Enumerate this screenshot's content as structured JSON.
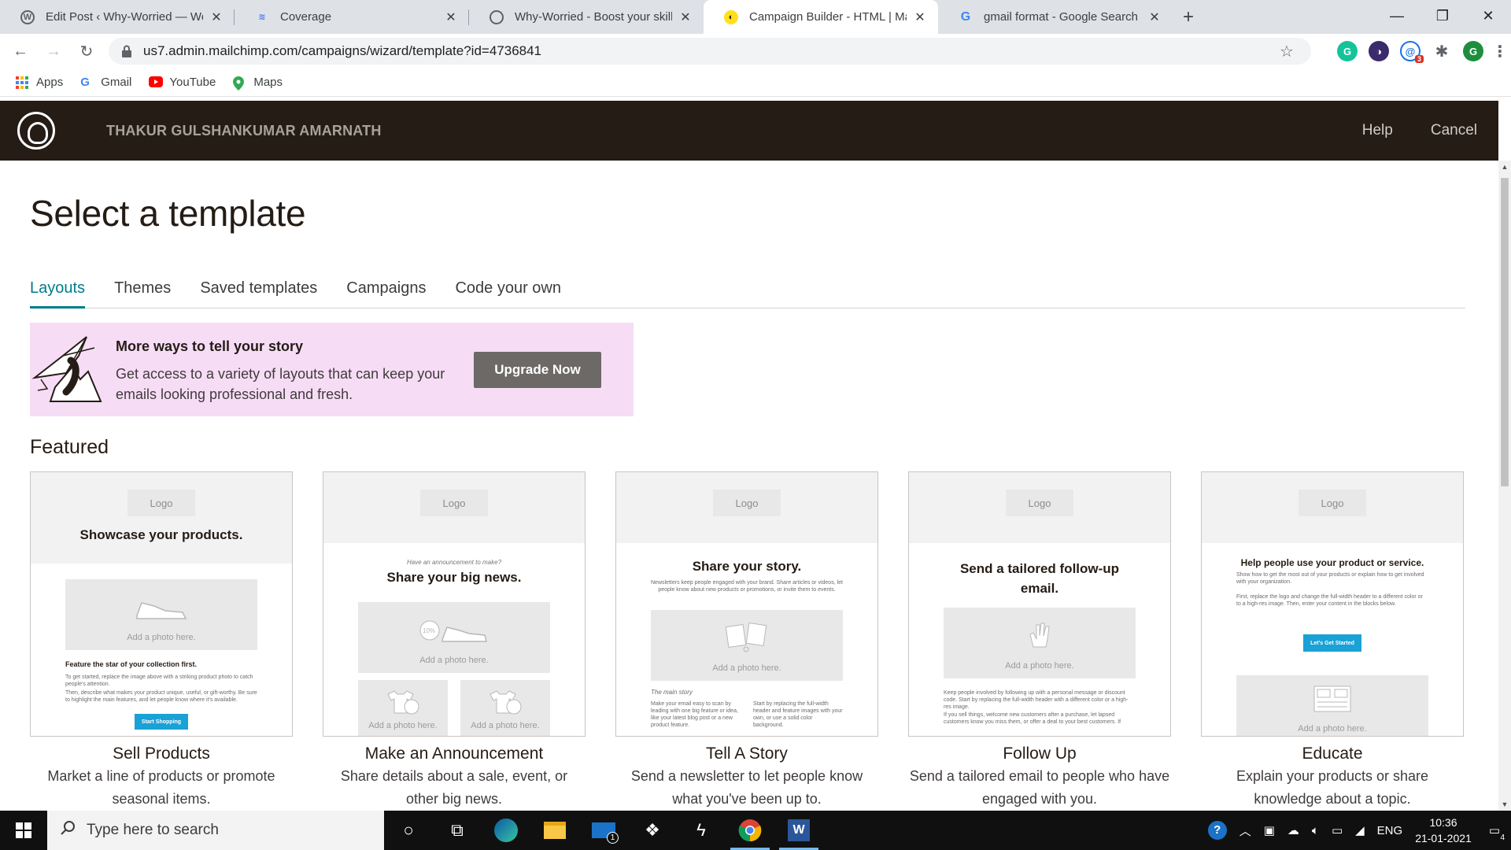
{
  "browser": {
    "tabs": [
      {
        "title": "Edit Post ‹ Why-Worried — Word",
        "favicon": "wordpress-icon",
        "active": false
      },
      {
        "title": "Coverage",
        "favicon": "search-console-icon",
        "active": false
      },
      {
        "title": "Why-Worried - Boost your skills",
        "favicon": "globe-icon",
        "active": false
      },
      {
        "title": "Campaign Builder - HTML | Mailc",
        "favicon": "mailchimp-icon",
        "active": true
      },
      {
        "title": "gmail format - Google Search",
        "favicon": "google-icon",
        "active": false
      }
    ],
    "close_glyph": "✕",
    "new_tab_glyph": "+",
    "url": "us7.admin.mailchimp.com/campaigns/wizard/template?id=4736841",
    "extension_badge": "3",
    "profile_initial": "G",
    "bookmarks": [
      {
        "label": "Apps",
        "icon": "apps-grid-icon"
      },
      {
        "label": "Gmail",
        "icon": "google-icon"
      },
      {
        "label": "YouTube",
        "icon": "youtube-icon"
      },
      {
        "label": "Maps",
        "icon": "maps-pin-icon"
      }
    ]
  },
  "header": {
    "account_name": "THAKUR GULSHANKUMAR AMARNATH",
    "help_label": "Help",
    "cancel_label": "Cancel"
  },
  "page": {
    "title": "Select a template",
    "tabs": [
      {
        "label": "Layouts",
        "active": true
      },
      {
        "label": "Themes",
        "active": false
      },
      {
        "label": "Saved templates",
        "active": false
      },
      {
        "label": "Campaigns",
        "active": false
      },
      {
        "label": "Code your own",
        "active": false
      }
    ],
    "promo": {
      "heading": "More ways to tell your story",
      "body": "Get access to a variety of layouts that can keep your emails looking professional and fresh.",
      "button_label": "Upgrade Now"
    },
    "featured_heading": "Featured",
    "templates": [
      {
        "name": "Sell Products",
        "description": "Market a line of products or promote seasonal items.",
        "preview": {
          "logo": "Logo",
          "headline": "Showcase your products.",
          "photo_placeholder": "Add a photo here.",
          "subhead": "Feature the star of your collection first.",
          "body1": "To get started, replace the image above with a striking product photo to catch people's attention.",
          "body2": "Then, describe what makes your product unique, useful, or gift-worthy. Be sure to highlight the main features, and let people know where it's available.",
          "cta": "Start Shopping"
        }
      },
      {
        "name": "Make an Announcement",
        "description": "Share details about a sale, event, or other big news.",
        "preview": {
          "logo": "Logo",
          "kicker": "Have an announcement to make?",
          "headline": "Share your big news.",
          "photo_placeholder": "Add a photo here.",
          "photo_small_1": "Add a photo here.",
          "photo_small_2": "Add a photo here."
        }
      },
      {
        "name": "Tell A Story",
        "description": "Send a newsletter to let people know what you've been up to.",
        "preview": {
          "logo": "Logo",
          "headline": "Share your story.",
          "body": "Newsletters keep people engaged with your brand. Share articles or videos, let people know about new products or promotions, or invite them to events.",
          "photo_placeholder": "Add a photo here.",
          "section": "The main story",
          "col1": "Make your email easy to scan by leading with one big feature or idea, like your latest blog post or a new product feature.",
          "col2": "Start by replacing the full-width header and feature images with your own, or use a solid color background."
        }
      },
      {
        "name": "Follow Up",
        "description": "Send a tailored email to people who have engaged with you.",
        "preview": {
          "logo": "Logo",
          "headline": "Send a tailored follow-up email.",
          "photo_placeholder": "Add a photo here.",
          "body1": "Keep people involved by following up with a personal message or discount code. Start by replacing the full-width header with a different color or a high-res image.",
          "body2": "If you sell things, welcome new customers after a purchase, let lapsed customers know you miss them, or offer a deal to your best customers. If"
        }
      },
      {
        "name": "Educate",
        "description": "Explain your products or share knowledge about a topic.",
        "preview": {
          "logo": "Logo",
          "headline": "Help people use your product or service.",
          "body1": "Show how to get the most out of your products or explain how to get involved with your organization.",
          "body2": "First, replace the logo and change the full-width header to a different color or to a high-res image. Then, enter your content in the blocks below.",
          "cta": "Let's Get Started",
          "photo_placeholder": "Add a photo here."
        }
      }
    ]
  },
  "taskbar": {
    "search_placeholder": "Type here to search",
    "mail_badge": "1",
    "language": "ENG",
    "time": "10:36",
    "date": "21-01-2021",
    "notification_count": "4"
  },
  "colors": {
    "mailchimp_header": "#241c15",
    "tab_active": "#007c89",
    "promo_bg": "#f6dcf5",
    "cta_blue": "#1aa1d6"
  }
}
